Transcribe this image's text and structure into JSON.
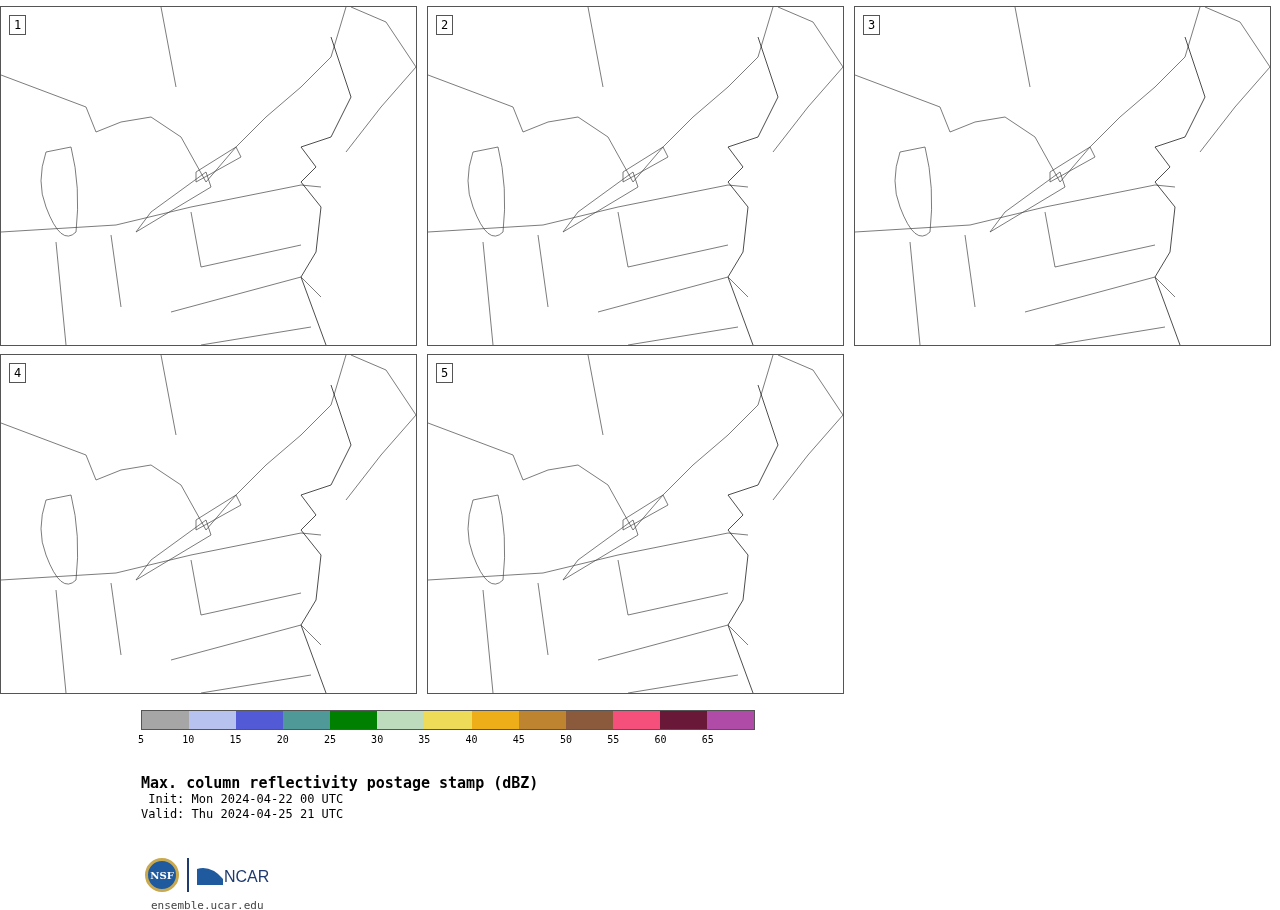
{
  "panels": [
    {
      "label": "1"
    },
    {
      "label": "2"
    },
    {
      "label": "3"
    },
    {
      "label": "4"
    },
    {
      "label": "5"
    }
  ],
  "colorbar": {
    "bins": [
      {
        "color": "#a6a6a6"
      },
      {
        "color": "#b7c2ee"
      },
      {
        "color": "#525ad6"
      },
      {
        "color": "#4f9999"
      },
      {
        "color": "#008000"
      },
      {
        "color": "#bddbbd"
      },
      {
        "color": "#eedb57"
      },
      {
        "color": "#eeae19"
      },
      {
        "color": "#bf8430"
      },
      {
        "color": "#8b5a3c"
      },
      {
        "color": "#f5507c"
      },
      {
        "color": "#6a1837"
      },
      {
        "color": "#b04ca7"
      }
    ],
    "ticks": [
      "5",
      "10",
      "15",
      "20",
      "25",
      "30",
      "35",
      "40",
      "45",
      "50",
      "55",
      "60",
      "65"
    ]
  },
  "title": "Max. column reflectivity postage stamp (dBZ)",
  "init": " Init: Mon 2024-04-22 00 UTC",
  "valid": "Valid: Thu 2024-04-25 21 UTC",
  "logo": {
    "left_text": "NSF",
    "right_text": "NCAR"
  },
  "footer_url": "ensemble.ucar.edu"
}
